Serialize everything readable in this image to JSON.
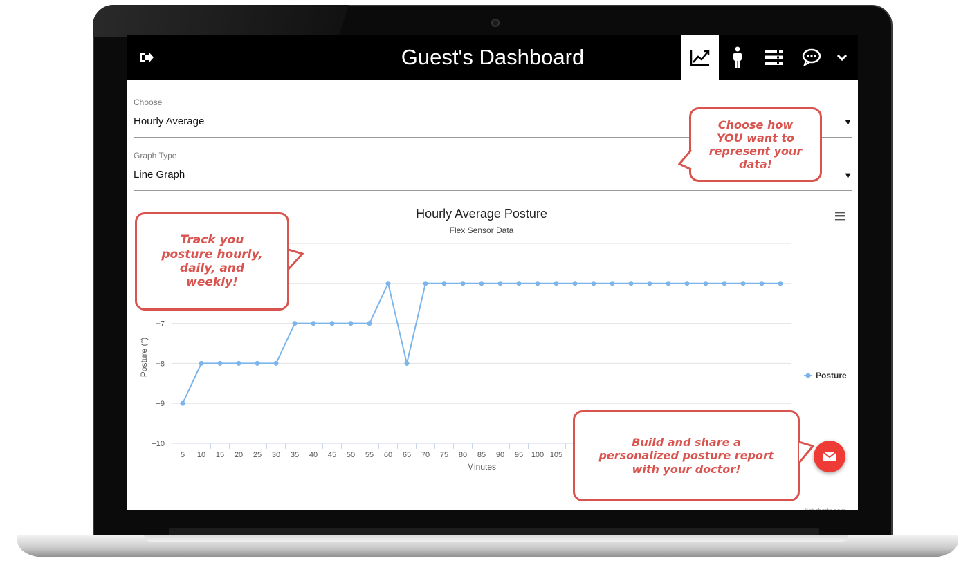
{
  "header": {
    "title": "Guest's Dashboard"
  },
  "nav_icons": [
    "logout-icon",
    "line-chart-icon",
    "person-icon",
    "list-icon",
    "chat-icon",
    "chevron-down-icon"
  ],
  "form": {
    "choose": {
      "label": "Choose",
      "value": "Hourly Average",
      "caret": "▼"
    },
    "graph_type": {
      "label": "Graph Type",
      "value": "Line Graph",
      "caret": "▼"
    }
  },
  "callouts": {
    "represent": "Choose how YOU want to represent your data!",
    "track": "Track you posture hourly, daily, and weekly!",
    "report": "Build and share a personalized posture report with your doctor!"
  },
  "chart_data": {
    "type": "line",
    "title": "Hourly Average Posture",
    "subtitle": "Flex Sensor Data",
    "xlabel": "Minutes",
    "ylabel": "Posture (°)",
    "x": [
      5,
      10,
      15,
      20,
      25,
      30,
      35,
      40,
      45,
      50,
      55,
      60,
      65,
      70,
      75,
      80,
      85,
      90,
      95,
      100,
      105,
      110,
      115,
      120,
      125,
      130,
      135,
      140,
      145,
      150,
      155,
      160,
      165,
      170
    ],
    "x_tick_labels": [
      "5",
      "10",
      "15",
      "20",
      "25",
      "30",
      "35",
      "40",
      "45",
      "50",
      "55",
      "60",
      "65",
      "70",
      "75",
      "80",
      "85",
      "90",
      "95",
      "100",
      "105",
      "1"
    ],
    "y_tick_labels": [
      "−7",
      "−8",
      "−9",
      "−10"
    ],
    "ylim": [
      -10,
      -5
    ],
    "series": [
      {
        "name": "Posture",
        "values": [
          -9,
          -8,
          -8,
          -8,
          -8,
          -8,
          -7,
          -7,
          -7,
          -7,
          -7,
          -6,
          -8,
          -6,
          -6,
          -6,
          -6,
          -6,
          -6,
          -6,
          -6,
          -6,
          -6,
          -6,
          -6,
          -6,
          -6,
          -6,
          -6,
          -6,
          -6,
          -6,
          -6,
          -6
        ]
      }
    ],
    "legend": {
      "position": "right",
      "label": "Posture"
    },
    "credits": "Highcharts.com",
    "grid": true,
    "color": "#7cb5ec"
  },
  "colors": {
    "accent": "#d9534f",
    "fab": "#ef3b36",
    "line": "#7cb5ec"
  }
}
